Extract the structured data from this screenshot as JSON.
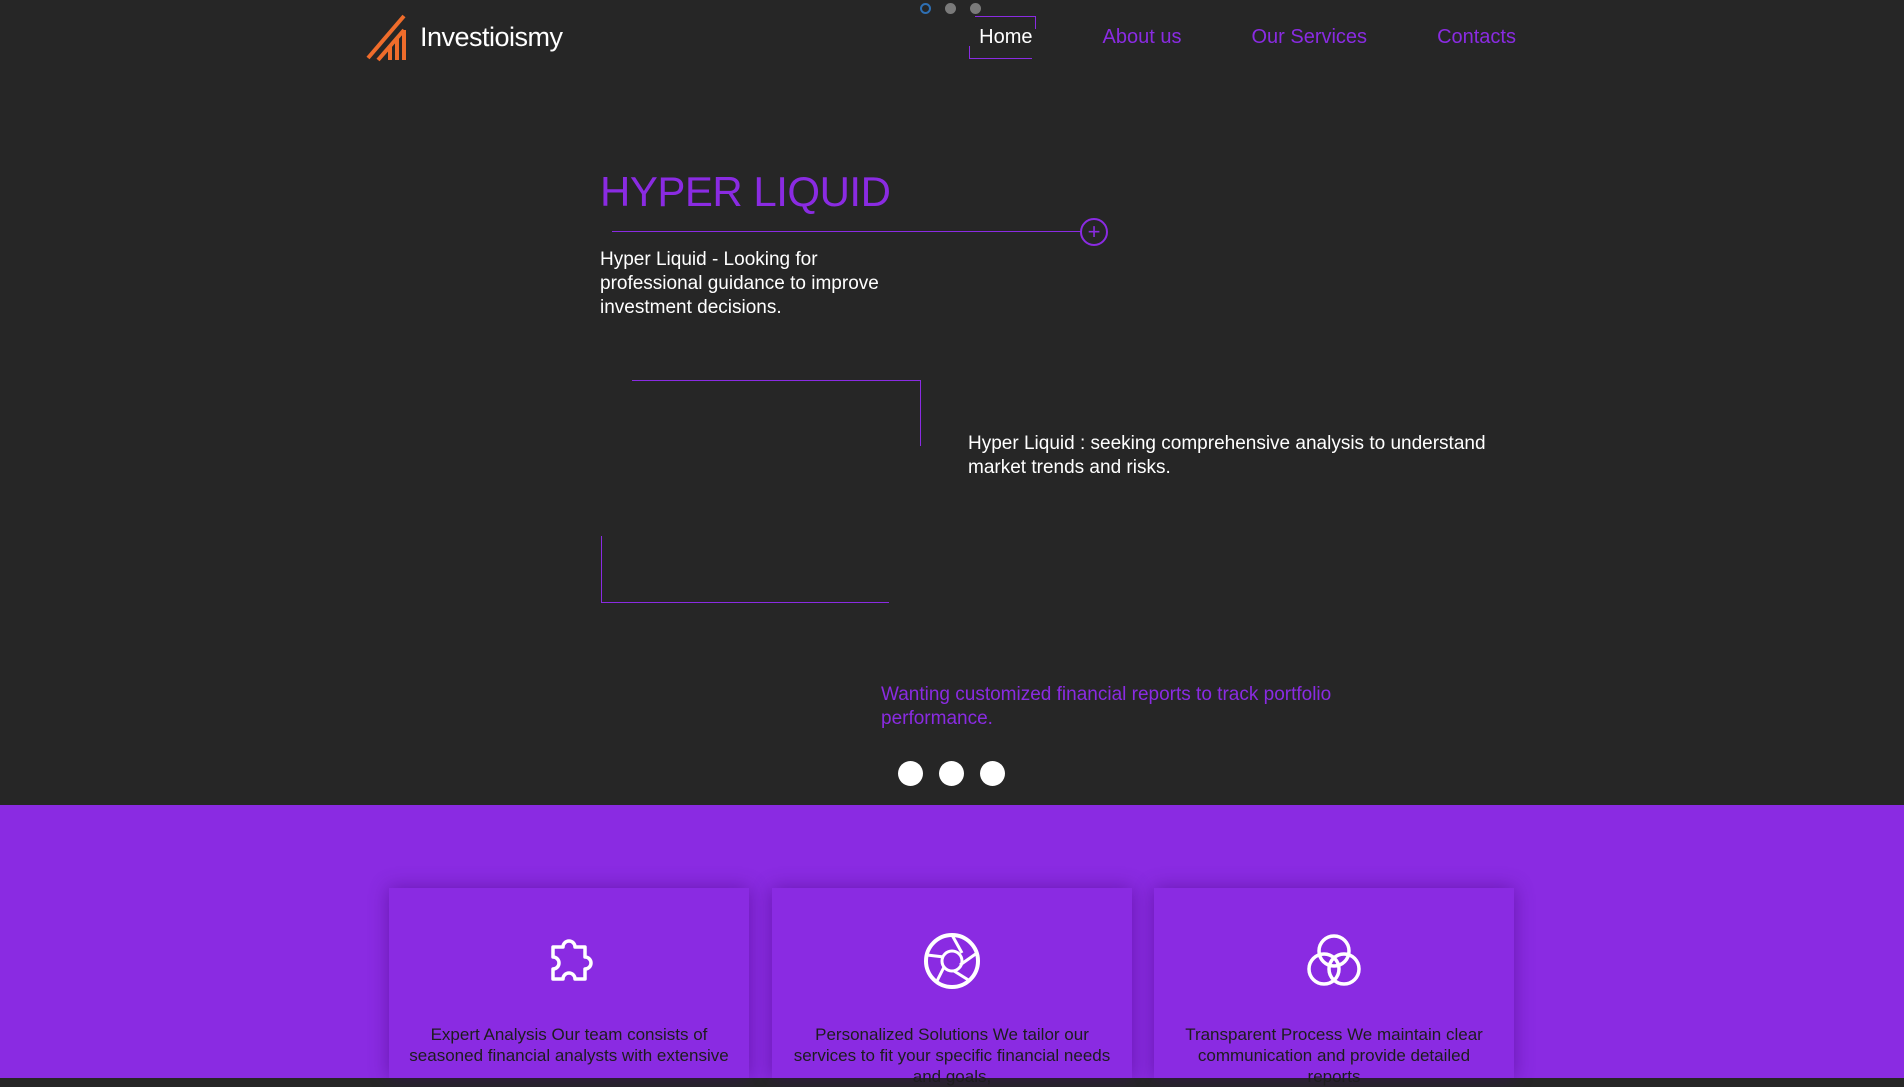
{
  "brand": {
    "name": "Investioismy",
    "logo_color": "#ef6c2b"
  },
  "nav": {
    "items": [
      {
        "label": "Home",
        "active": true
      },
      {
        "label": "About us",
        "active": false
      },
      {
        "label": "Our Services",
        "active": false
      },
      {
        "label": "Contacts",
        "active": false
      }
    ]
  },
  "top_pager": {
    "count": 3,
    "active_index": 0
  },
  "hero": {
    "title": "HYPER LIQUID",
    "plus_icon": "plus-circle-icon",
    "text1": "Hyper Liquid - Looking for professional guidance to improve investment decisions.",
    "text2_main": "Hyper Liquid : seeking comprehensive analysis to understand market trends and risks.",
    "text3": "Wanting customized financial reports to track portfolio performance."
  },
  "slider": {
    "count": 3
  },
  "features": {
    "cards": [
      {
        "icon": "puzzle-icon",
        "text": "Expert Analysis Our team consists of seasoned financial analysts with extensive"
      },
      {
        "icon": "aperture-icon",
        "text": "Personalized Solutions We tailor our services to fit your specific financial needs and goals,"
      },
      {
        "icon": "intersecting-circles-icon",
        "text": "Transparent Process We maintain clear communication and provide detailed reports"
      }
    ]
  },
  "colors": {
    "background": "#262626",
    "accent": "#8a2be2",
    "text": "#ffffff"
  }
}
